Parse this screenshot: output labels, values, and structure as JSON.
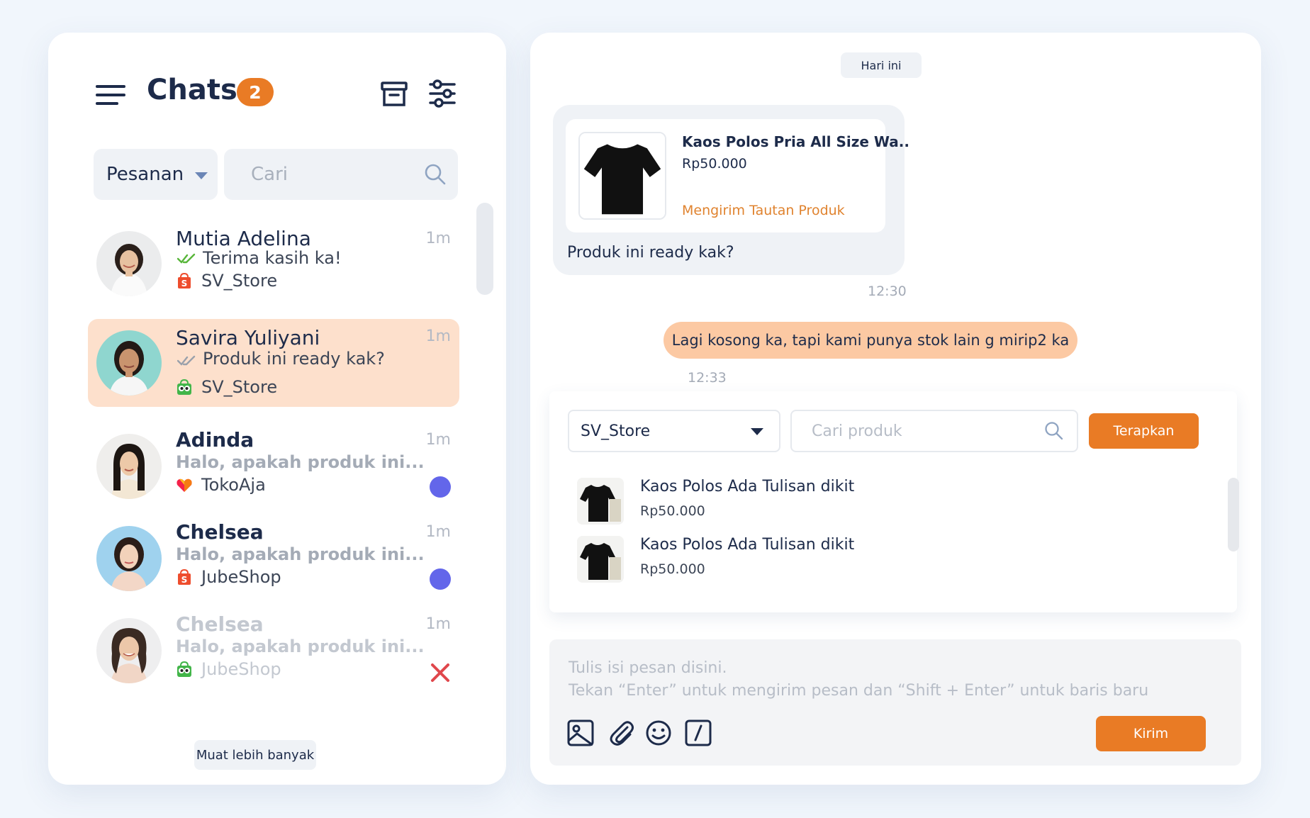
{
  "sidebar": {
    "title": "Chats",
    "unread_count": "2",
    "filter": {
      "selected": "Pesanan"
    },
    "search": {
      "placeholder": "Cari"
    },
    "load_more_label": "Muat lebih banyak",
    "chats": [
      {
        "name": "Mutia Adelina",
        "time": "1m",
        "preview": "Terima kasih ka!",
        "store": "SV_Store",
        "marketplace": "shopee",
        "status": "read",
        "active": false
      },
      {
        "name": "Savira Yuliyani",
        "time": "1m",
        "preview": "Produk ini ready kak?",
        "store": "SV_Store",
        "marketplace": "tokopedia",
        "status": "sent",
        "active": true
      },
      {
        "name": "Adinda",
        "time": "1m",
        "preview": "Halo, apakah produk ini...",
        "store": "TokoAja",
        "marketplace": "lazada",
        "status": "unread",
        "active": false
      },
      {
        "name": "Chelsea",
        "time": "1m",
        "preview": "Halo, apakah produk ini...",
        "store": "JubeShop",
        "marketplace": "shopee",
        "status": "unread",
        "active": false
      },
      {
        "name": "Chelsea",
        "time": "1m",
        "preview": "Halo, apakah produk ini...",
        "store": "JubeShop",
        "marketplace": "tokopedia",
        "status": "failed",
        "active": false
      }
    ]
  },
  "conversation": {
    "date_label": "Hari ini",
    "incoming": {
      "product_name": "Kaos Polos Pria All Size Wa..",
      "product_price": "Rp50.000",
      "product_link_label": "Mengirim Tautan Produk",
      "text": "Produk ini ready kak?",
      "time": "12:30"
    },
    "outgoing": {
      "text": "Lagi kosong ka, tapi kami punya stok lain g mirip2 ka",
      "time": "12:33"
    }
  },
  "product_picker": {
    "store_selected": "SV_Store",
    "search_placeholder": "Cari produk",
    "apply_label": "Terapkan",
    "products": [
      {
        "name": "Kaos Polos Ada Tulisan dikit",
        "price": "Rp50.000"
      },
      {
        "name": "Kaos Polos Ada Tulisan dikit",
        "price": "Rp50.000"
      }
    ]
  },
  "composer": {
    "placeholder_line1": "Tulis isi pesan disini.",
    "placeholder_line2": "Tekan “Enter” untuk mengirim pesan dan “Shift + Enter” untuk baris baru",
    "send_label": "Kirim",
    "tools": [
      "image-icon",
      "attachment-icon",
      "emoji-icon",
      "slash-command-icon"
    ]
  },
  "colors": {
    "accent": "#e97b25",
    "active_chat_bg": "#fde0cc",
    "outgoing_bubble": "#fcc9a3",
    "unread_dot": "#6366ea",
    "error": "#e0474c",
    "page_bg": "#f1f6fc"
  }
}
